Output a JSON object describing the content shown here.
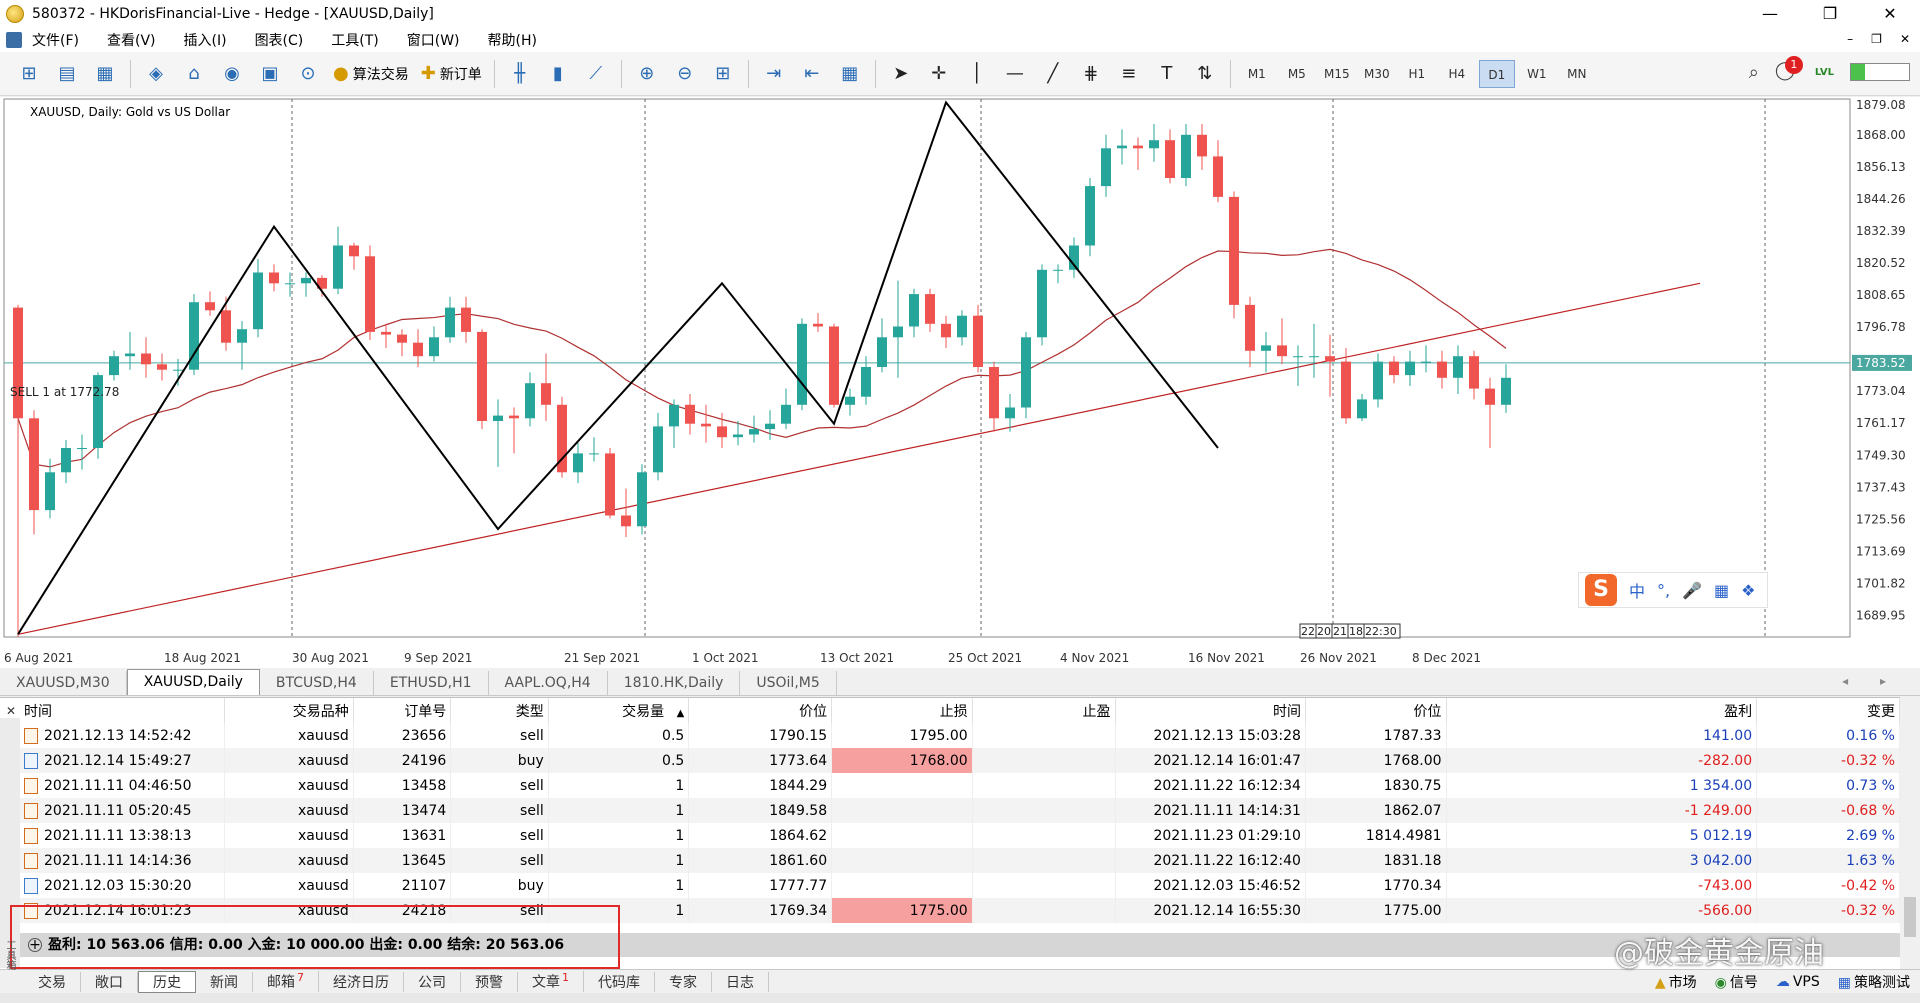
{
  "window": {
    "title": "580372 - HKDorisFinancial-Live - Hedge - [XAUUSD,Daily]",
    "controls": [
      "—",
      "❐",
      "✕"
    ]
  },
  "menu": {
    "items": [
      "文件(F)",
      "查看(V)",
      "插入(I)",
      "图表(C)",
      "工具(T)",
      "窗口(W)",
      "帮助(H)"
    ],
    "mdi_controls": [
      "–",
      "❐",
      "✕"
    ]
  },
  "toolbar": {
    "algo_trading": "算法交易",
    "new_order": "新订单",
    "timeframes": [
      "M1",
      "M5",
      "M15",
      "M30",
      "H1",
      "H4",
      "D1",
      "W1",
      "MN"
    ],
    "active_timeframe": "D1",
    "notification_count": "1",
    "lvl": "LVL"
  },
  "chart": {
    "label": "XAUUSD, Daily:  Gold vs US Dollar",
    "sell_label": "SELL 1 at 1772.78",
    "current_price": "1783.52",
    "price_labels": [
      "1879.08",
      "1868.00",
      "1856.13",
      "1844.26",
      "1832.39",
      "1820.52",
      "1808.65",
      "1796.78",
      "1773.04",
      "1761.17",
      "1749.30",
      "1737.43",
      "1725.56",
      "1713.69",
      "1701.82",
      "1689.95"
    ],
    "date_labels": [
      "6 Aug 2021",
      "18 Aug 2021",
      "30 Aug 2021",
      "9 Sep 2021",
      "21 Sep 2021",
      "1 Oct 2021",
      "13 Oct 2021",
      "25 Oct 2021",
      "4 Nov 2021",
      "16 Nov 2021",
      "26 Nov 2021",
      "8 Dec 2021"
    ],
    "time_tags": [
      "22",
      "20",
      "21",
      "18",
      "22:30"
    ],
    "colors": {
      "bull": "#26a69a",
      "bear": "#ef5350",
      "ma": "#b03030",
      "zigzag": "#000000",
      "trend": "#c02020",
      "price_line": "#4aa8a0"
    }
  },
  "chart_data": {
    "type": "candlestick",
    "x": [
      "2021-08-06",
      "2021-08-09",
      "2021-08-10",
      "2021-08-11",
      "2021-08-12",
      "2021-08-13",
      "2021-08-16",
      "2021-08-17",
      "2021-08-18",
      "2021-08-19",
      "2021-08-20",
      "2021-08-23",
      "2021-08-24",
      "2021-08-25",
      "2021-08-26",
      "2021-08-27",
      "2021-08-30",
      "2021-08-31",
      "2021-09-01",
      "2021-09-02",
      "2021-09-03",
      "2021-09-06",
      "2021-09-07",
      "2021-09-08",
      "2021-09-09",
      "2021-09-10",
      "2021-09-13",
      "2021-09-14",
      "2021-09-15",
      "2021-09-16",
      "2021-09-17",
      "2021-09-20",
      "2021-09-21",
      "2021-09-22",
      "2021-09-23",
      "2021-09-24",
      "2021-09-27",
      "2021-09-28",
      "2021-09-29",
      "2021-09-30",
      "2021-10-01",
      "2021-10-04",
      "2021-10-05",
      "2021-10-06",
      "2021-10-07",
      "2021-10-08",
      "2021-10-11",
      "2021-10-12",
      "2021-10-13",
      "2021-10-14",
      "2021-10-15",
      "2021-10-18",
      "2021-10-19",
      "2021-10-20",
      "2021-10-21",
      "2021-10-22",
      "2021-10-25",
      "2021-10-26",
      "2021-10-27",
      "2021-10-28",
      "2021-10-29",
      "2021-11-01",
      "2021-11-02",
      "2021-11-03",
      "2021-11-04",
      "2021-11-05",
      "2021-11-08",
      "2021-11-09",
      "2021-11-10",
      "2021-11-11",
      "2021-11-12",
      "2021-11-15",
      "2021-11-16",
      "2021-11-17",
      "2021-11-18",
      "2021-11-19",
      "2021-11-22",
      "2021-11-23",
      "2021-11-24",
      "2021-11-25",
      "2021-11-26",
      "2021-11-29",
      "2021-11-30",
      "2021-12-01",
      "2021-12-02",
      "2021-12-03",
      "2021-12-06",
      "2021-12-07",
      "2021-12-08",
      "2021-12-09",
      "2021-12-10",
      "2021-12-13",
      "2021-12-14",
      "2021-12-15"
    ],
    "open": [
      1804,
      1763,
      1729,
      1743,
      1752,
      1752,
      1779,
      1786,
      1787,
      1783,
      1781,
      1781,
      1806,
      1803,
      1791,
      1796,
      1817,
      1813,
      1813,
      1815,
      1811,
      1827,
      1823,
      1795,
      1794,
      1791,
      1786,
      1793,
      1804,
      1795,
      1762,
      1764,
      1763,
      1776,
      1768,
      1743,
      1750,
      1750,
      1727,
      1723,
      1743,
      1760,
      1768,
      1761,
      1760,
      1756,
      1757,
      1759,
      1761,
      1768,
      1798,
      1797,
      1768,
      1771,
      1782,
      1793,
      1797,
      1809,
      1798,
      1793,
      1801,
      1782,
      1763,
      1767,
      1793,
      1818,
      1818,
      1827,
      1849,
      1863,
      1864,
      1863,
      1866,
      1852,
      1868,
      1860,
      1845,
      1805,
      1788,
      1790,
      1786,
      1786,
      1786,
      1784,
      1763,
      1770,
      1784,
      1779,
      1784,
      1784,
      1778,
      1786,
      1774,
      1768
    ],
    "close": [
      1763,
      1729,
      1743,
      1752,
      1752,
      1779,
      1786,
      1787,
      1783,
      1781,
      1781,
      1806,
      1803,
      1791,
      1796,
      1817,
      1813,
      1813,
      1815,
      1811,
      1827,
      1823,
      1795,
      1794,
      1791,
      1786,
      1793,
      1804,
      1795,
      1762,
      1764,
      1763,
      1776,
      1768,
      1743,
      1750,
      1750,
      1727,
      1723,
      1743,
      1760,
      1768,
      1761,
      1760,
      1756,
      1757,
      1759,
      1761,
      1768,
      1798,
      1797,
      1768,
      1771,
      1782,
      1793,
      1797,
      1809,
      1798,
      1793,
      1801,
      1782,
      1763,
      1767,
      1793,
      1818,
      1818,
      1827,
      1849,
      1863,
      1864,
      1863,
      1866,
      1852,
      1868,
      1860,
      1845,
      1805,
      1788,
      1790,
      1786,
      1786,
      1786,
      1784,
      1763,
      1770,
      1784,
      1779,
      1784,
      1784,
      1778,
      1786,
      1774,
      1768,
      1778
    ],
    "high": [
      1805,
      1766,
      1748,
      1755,
      1757,
      1780,
      1788,
      1795,
      1793,
      1787,
      1785,
      1809,
      1810,
      1808,
      1799,
      1822,
      1820,
      1817,
      1817,
      1816,
      1834,
      1828,
      1827,
      1798,
      1796,
      1796,
      1797,
      1808,
      1808,
      1796,
      1770,
      1767,
      1780,
      1787,
      1771,
      1754,
      1756,
      1752,
      1737,
      1746,
      1765,
      1770,
      1772,
      1768,
      1765,
      1762,
      1764,
      1766,
      1774,
      1800,
      1802,
      1798,
      1774,
      1786,
      1800,
      1814,
      1811,
      1811,
      1801,
      1803,
      1805,
      1784,
      1772,
      1795,
      1820,
      1820,
      1830,
      1852,
      1868,
      1870,
      1867,
      1872,
      1870,
      1872,
      1872,
      1866,
      1847,
      1808,
      1795,
      1800,
      1790,
      1798,
      1794,
      1789,
      1772,
      1787,
      1786,
      1788,
      1790,
      1788,
      1790,
      1788,
      1778,
      1783
    ],
    "low": [
      1682,
      1720,
      1726,
      1739,
      1744,
      1748,
      1777,
      1781,
      1778,
      1777,
      1775,
      1779,
      1801,
      1788,
      1781,
      1793,
      1810,
      1808,
      1808,
      1808,
      1809,
      1818,
      1792,
      1789,
      1786,
      1782,
      1784,
      1791,
      1791,
      1759,
      1745,
      1750,
      1760,
      1762,
      1741,
      1739,
      1747,
      1726,
      1719,
      1720,
      1740,
      1752,
      1757,
      1754,
      1752,
      1753,
      1754,
      1755,
      1759,
      1766,
      1795,
      1767,
      1764,
      1768,
      1780,
      1778,
      1793,
      1795,
      1789,
      1790,
      1780,
      1758,
      1758,
      1763,
      1790,
      1813,
      1815,
      1823,
      1845,
      1857,
      1855,
      1858,
      1850,
      1849,
      1855,
      1843,
      1800,
      1782,
      1780,
      1783,
      1775,
      1778,
      1771,
      1761,
      1762,
      1767,
      1776,
      1775,
      1780,
      1774,
      1772,
      1770,
      1752,
      1765
    ],
    "ylim": [
      1682,
      1882
    ]
  },
  "chart_tabs": {
    "items": [
      "XAUUSD,M30",
      "XAUUSD,Daily",
      "BTCUSD,H4",
      "ETHUSD,H1",
      "AAPL.OQ,H4",
      "1810.HK,Daily",
      "USOil,M5"
    ],
    "active": "XAUUSD,Daily",
    "arrows": "◂ ▸"
  },
  "terminal": {
    "close_icon": "✕",
    "headers": [
      "时间",
      "交易品种",
      "订单号",
      "类型",
      "交易量",
      "价位",
      "止损",
      "止盈",
      "时间",
      "价位",
      "盈利",
      "变更"
    ],
    "sort_arrow": "▲",
    "rows": [
      {
        "open_time": "2021.12.13 14:52:42",
        "symbol": "xauusd",
        "ticket": "23656",
        "type": "sell",
        "volume": "0.5",
        "price": "1790.15",
        "sl": "1795.00",
        "tp": "",
        "close_time": "2021.12.13 15:03:28",
        "close_price": "1787.33",
        "profit": "141.00",
        "change": "0.16 %",
        "sign": "pos"
      },
      {
        "open_time": "2021.12.14 15:49:27",
        "symbol": "xauusd",
        "ticket": "24196",
        "type": "buy",
        "volume": "0.5",
        "price": "1773.64",
        "sl": "1768.00",
        "tp": "",
        "close_time": "2021.12.14 16:01:47",
        "close_price": "1768.00",
        "profit": "-282.00",
        "change": "-0.32 %",
        "sign": "neg",
        "sl_hit": true
      },
      {
        "open_time": "2021.11.11 04:46:50",
        "symbol": "xauusd",
        "ticket": "13458",
        "type": "sell",
        "volume": "1",
        "price": "1844.29",
        "sl": "",
        "tp": "",
        "close_time": "2021.11.22 16:12:34",
        "close_price": "1830.75",
        "profit": "1 354.00",
        "change": "0.73 %",
        "sign": "pos"
      },
      {
        "open_time": "2021.11.11 05:20:45",
        "symbol": "xauusd",
        "ticket": "13474",
        "type": "sell",
        "volume": "1",
        "price": "1849.58",
        "sl": "",
        "tp": "",
        "close_time": "2021.11.11 14:14:31",
        "close_price": "1862.07",
        "profit": "-1 249.00",
        "change": "-0.68 %",
        "sign": "neg"
      },
      {
        "open_time": "2021.11.11 13:38:13",
        "symbol": "xauusd",
        "ticket": "13631",
        "type": "sell",
        "volume": "1",
        "price": "1864.62",
        "sl": "",
        "tp": "",
        "close_time": "2021.11.23 01:29:10",
        "close_price": "1814.4981",
        "profit": "5 012.19",
        "change": "2.69 %",
        "sign": "pos"
      },
      {
        "open_time": "2021.11.11 14:14:36",
        "symbol": "xauusd",
        "ticket": "13645",
        "type": "sell",
        "volume": "1",
        "price": "1861.60",
        "sl": "",
        "tp": "",
        "close_time": "2021.11.22 16:12:40",
        "close_price": "1831.18",
        "profit": "3 042.00",
        "change": "1.63 %",
        "sign": "pos"
      },
      {
        "open_time": "2021.12.03 15:30:20",
        "symbol": "xauusd",
        "ticket": "21107",
        "type": "buy",
        "volume": "1",
        "price": "1777.77",
        "sl": "",
        "tp": "",
        "close_time": "2021.12.03 15:46:52",
        "close_price": "1770.34",
        "profit": "-743.00",
        "change": "-0.42 %",
        "sign": "neg"
      },
      {
        "open_time": "2021.12.14 16:01:23",
        "symbol": "xauusd",
        "ticket": "24218",
        "type": "sell",
        "volume": "1",
        "price": "1769.34",
        "sl": "1775.00",
        "tp": "",
        "close_time": "2021.12.14 16:55:30",
        "close_price": "1775.00",
        "profit": "-566.00",
        "change": "-0.32 %",
        "sign": "neg",
        "sl_hit": true
      }
    ],
    "summary": "盈利: 10 563.06  信用: 0.00  入金: 10 000.00  出金: 0.00  结余: 20 563.06"
  },
  "bottom_tabs": {
    "items": [
      "交易",
      "敞口",
      "历史",
      "新闻",
      "邮箱",
      "经济日历",
      "公司",
      "预警",
      "文章",
      "代码库",
      "专家",
      "日志"
    ],
    "active": "历史",
    "badges": {
      "邮箱": "7",
      "文章": "1"
    },
    "side_label": "工具箱",
    "right": [
      "市场",
      "信号",
      "VPS",
      "策略测试"
    ]
  },
  "ime": {
    "chars": [
      "中",
      "°,",
      "🎤",
      "▦",
      "❖"
    ],
    "logo": "S"
  },
  "watermark": "@破金黄金原油"
}
